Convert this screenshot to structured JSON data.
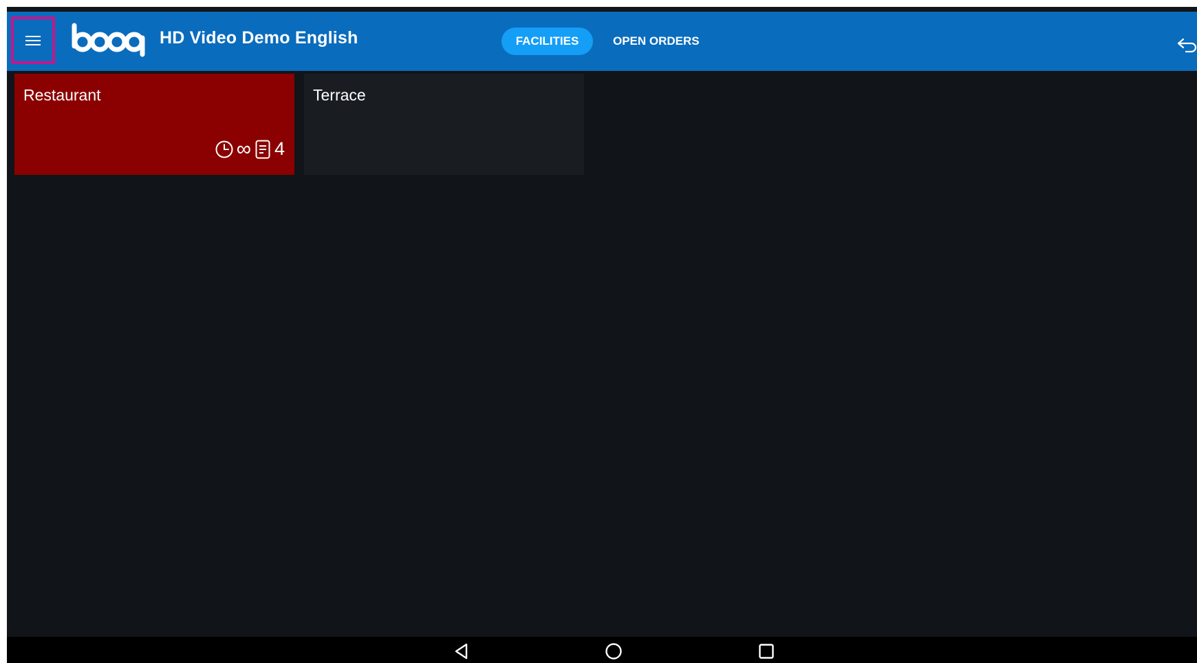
{
  "header": {
    "menu_icon": "hamburger-menu-icon",
    "logo_text": "booq",
    "title": "HD Video Demo English",
    "tabs": [
      {
        "label": "FACILITIES",
        "active": true
      },
      {
        "label": "OPEN ORDERS",
        "active": false
      }
    ],
    "back_icon": "return-arrow-icon"
  },
  "facilities": [
    {
      "name": "Restaurant",
      "color": "#8b0000",
      "duration_symbol": "∞",
      "order_count": "4",
      "icons": [
        "clock-icon",
        "receipt-icon"
      ]
    },
    {
      "name": "Terrace",
      "color": "#191d22"
    }
  ],
  "system_nav": {
    "icons": [
      "back-triangle-icon",
      "home-circle-icon",
      "recents-square-icon"
    ]
  },
  "colors": {
    "header_bg": "#0a6cbd",
    "active_tab_bg": "#149ef6",
    "content_bg": "#111418",
    "highlight_border": "#c2188c"
  }
}
